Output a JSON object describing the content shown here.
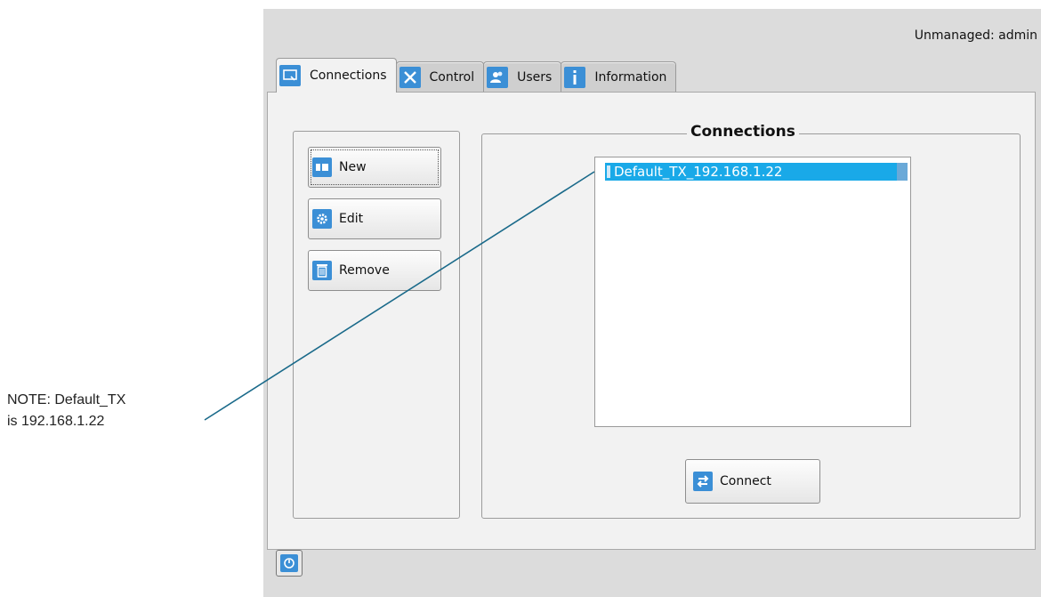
{
  "header": {
    "user_status": "Unmanaged: admin"
  },
  "tabs": [
    {
      "label": "Connections",
      "icon": "monitor-icon",
      "active": true
    },
    {
      "label": "Control",
      "icon": "tools-icon",
      "active": false
    },
    {
      "label": "Users",
      "icon": "users-icon",
      "active": false
    },
    {
      "label": "Information",
      "icon": "info-icon",
      "active": false
    }
  ],
  "actions": {
    "new_label": "New",
    "edit_label": "Edit",
    "remove_label": "Remove"
  },
  "connections": {
    "title": "Connections",
    "items": [
      {
        "label": "Default_TX_192.168.1.22",
        "selected": true
      }
    ],
    "connect_label": "Connect"
  },
  "footer": {
    "icon": "power-icon"
  },
  "annotation": {
    "line1": "NOTE: Default_TX",
    "line2": "is 192.168.1.22"
  },
  "colors": {
    "accent": "#3b8fd6",
    "selection": "#19a9e8",
    "callout_line": "#1a6a8a",
    "background": "#dcdcdc"
  }
}
